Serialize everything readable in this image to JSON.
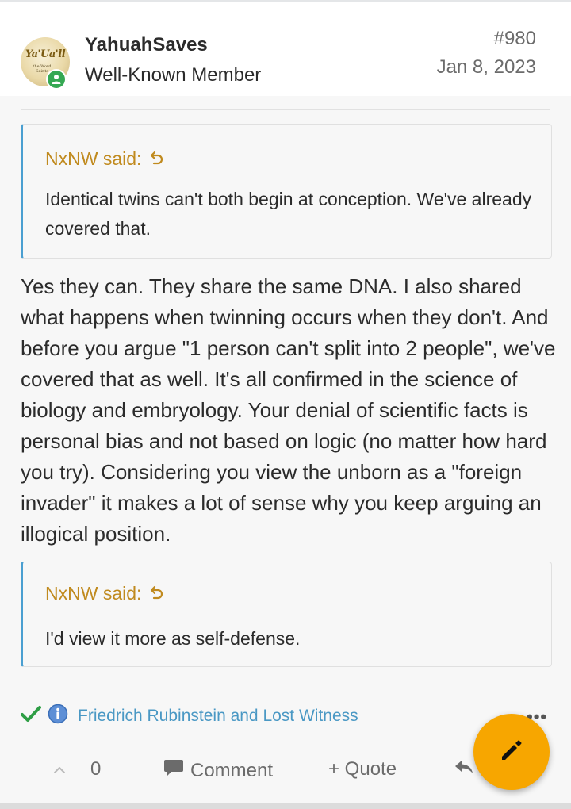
{
  "post": {
    "username": "YahuahSaves",
    "user_title": "Well-Known Member",
    "number": "#980",
    "date": "Jan 8, 2023",
    "avatar_text": "Ya'Ua'll",
    "avatar_subtext": "the Word Saints"
  },
  "quotes": [
    {
      "attribution": "NxNW said:",
      "text": "Identical twins can't both begin at conception. We've already covered that."
    },
    {
      "attribution": "NxNW said:",
      "text": "I'd view it more as self-defense."
    }
  ],
  "body": "Yes they can. They share the same DNA. I also shared what happens when twinning occurs when they don't. And before you argue \"1 person can't split into 2 people\", we've covered that as well. It's all confirmed in the science of biology and embryology. Your denial of scientific facts is personal bias and not based on logic (no matter how hard you try). Considering you view the unborn as a \"foreign invader\" it makes a lot of sense why you keep arguing an illogical position.",
  "reactions": {
    "names": "Friedrich Rubinstein and Lost Witness",
    "more": "•••"
  },
  "actions": {
    "vote_count": "0",
    "comment_label": "Comment",
    "quote_label": "+ Quote"
  },
  "colors": {
    "accent_gold": "#c08a1e",
    "quote_border": "#4a9fd1",
    "link_blue": "#4a98c4",
    "fab": "#f7a600",
    "online": "#35a853"
  }
}
